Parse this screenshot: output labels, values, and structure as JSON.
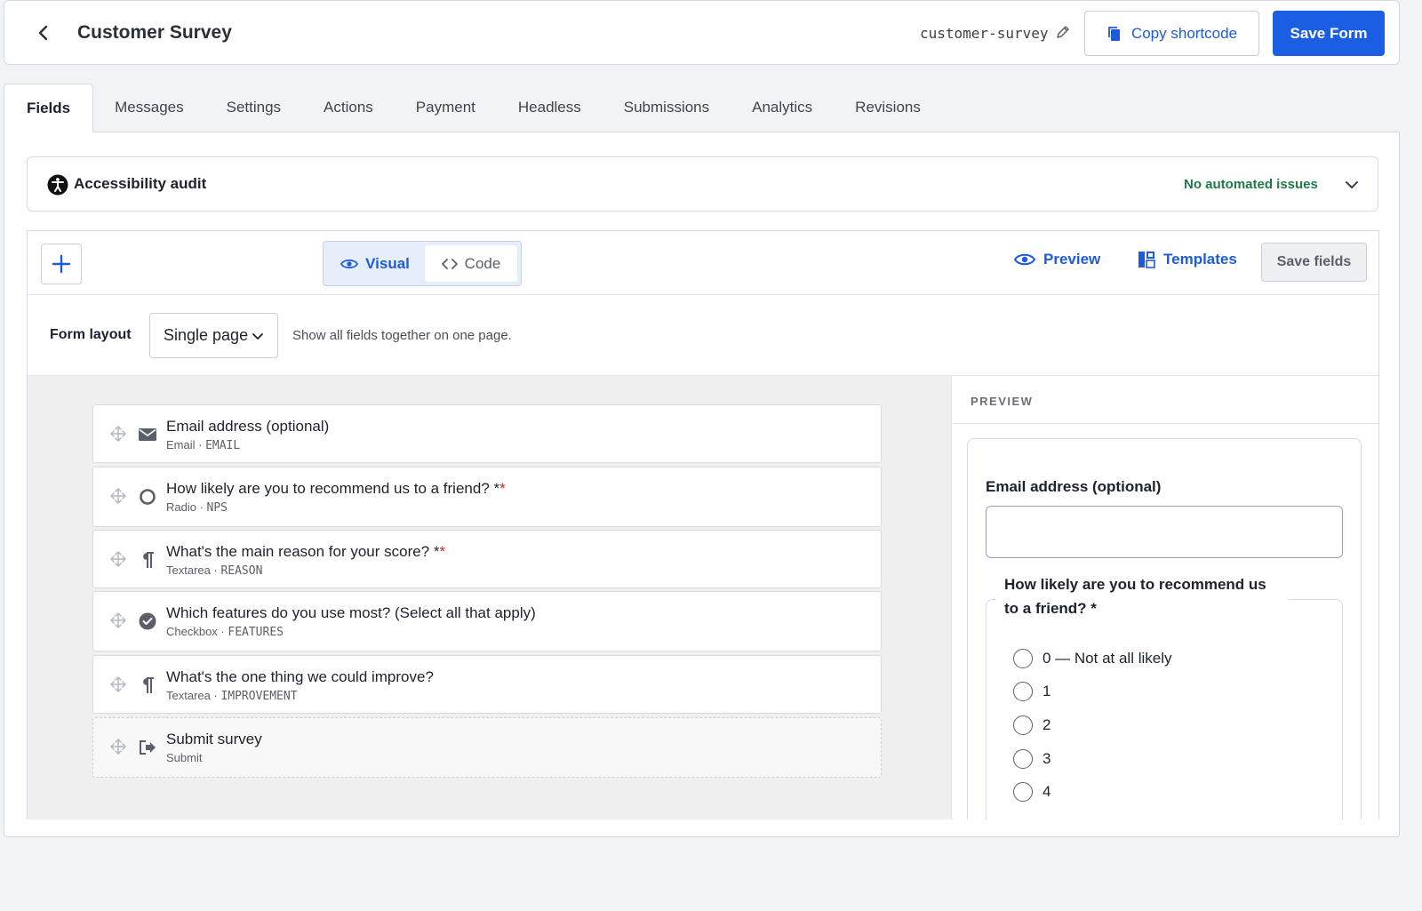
{
  "header": {
    "title": "Customer Survey",
    "slug": "customer-survey",
    "copy_label": "Copy shortcode",
    "save_label": "Save Form"
  },
  "tabs": [
    {
      "label": "Fields",
      "active": true
    },
    {
      "label": "Messages"
    },
    {
      "label": "Settings"
    },
    {
      "label": "Actions"
    },
    {
      "label": "Payment"
    },
    {
      "label": "Headless"
    },
    {
      "label": "Submissions"
    },
    {
      "label": "Analytics"
    },
    {
      "label": "Revisions"
    }
  ],
  "audit": {
    "title": "Accessibility audit",
    "status": "No automated issues",
    "status_color": "#1f7a4a"
  },
  "toolbar": {
    "visual_label": "Visual",
    "code_label": "Code",
    "preview_label": "Preview",
    "templates_label": "Templates",
    "save_fields_label": "Save fields"
  },
  "layout": {
    "label": "Form layout",
    "value": "Single page",
    "help": "Show all fields together on one page."
  },
  "fields": [
    {
      "label": "Email address (optional)",
      "required": false,
      "type": "Email",
      "key": "EMAIL",
      "icon": "envelope-icon"
    },
    {
      "label": "How likely are you to recommend us to a friend? *",
      "required": true,
      "type": "Radio",
      "key": "NPS",
      "icon": "radio-icon"
    },
    {
      "label": "What's the main reason for your score? *",
      "required": true,
      "type": "Textarea",
      "key": "REASON",
      "icon": "pilcrow-icon"
    },
    {
      "label": "Which features do you use most? (Select all that apply)",
      "required": false,
      "type": "Checkbox",
      "key": "FEATURES",
      "icon": "check-circle-icon"
    },
    {
      "label": "What's the one thing we could improve?",
      "required": false,
      "type": "Textarea",
      "key": "IMPROVEMENT",
      "icon": "pilcrow-icon"
    },
    {
      "label": "Submit survey",
      "required": false,
      "type": "Submit",
      "key": "",
      "icon": "submit-icon"
    }
  ],
  "preview": {
    "heading": "PREVIEW",
    "email_label": "Email address (optional)",
    "nps_legend": "How likely are you to recommend us to a friend? *",
    "options": [
      "0 — Not at all likely",
      "1",
      "2",
      "3",
      "4"
    ]
  },
  "colors": {
    "accent": "#1c5ee3",
    "required": "#d32424"
  }
}
